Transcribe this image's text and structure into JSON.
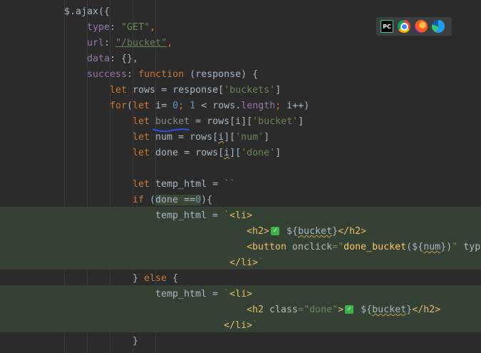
{
  "code_lines": [
    {
      "indent": "$",
      "parts": []
    },
    {
      "parts": []
    }
  ],
  "editor": {
    "lines": [
      {
        "segments": [
          {
            "t": "$.ajax({",
            "c": "plain"
          }
        ]
      },
      {
        "segments": [
          {
            "t": "type",
            "c": "prop"
          },
          {
            "t": ": ",
            "c": "plain"
          },
          {
            "t": "\"GET\"",
            "c": "str"
          },
          {
            "t": ",",
            "c": "kw"
          }
        ]
      },
      {
        "segments": [
          {
            "t": "url",
            "c": "prop"
          },
          {
            "t": ": ",
            "c": "plain"
          },
          {
            "t": "\"/bucket\"",
            "c": "str ul"
          },
          {
            "t": ",",
            "c": "kw"
          }
        ]
      },
      {
        "segments": [
          {
            "t": "data",
            "c": "prop"
          },
          {
            "t": ": {},",
            "c": "plain"
          }
        ]
      },
      {
        "segments": [
          {
            "t": "success",
            "c": "prop"
          },
          {
            "t": ": ",
            "c": "plain"
          },
          {
            "t": "function",
            "c": "kw"
          },
          {
            "t": " (response) {",
            "c": "plain"
          }
        ]
      },
      {
        "segments": [
          {
            "t": "let",
            "c": "kw"
          },
          {
            "t": " rows = response[",
            "c": "plain"
          },
          {
            "t": "'buckets'",
            "c": "str"
          },
          {
            "t": "]",
            "c": "plain"
          }
        ]
      },
      {
        "segments": [
          {
            "t": "for",
            "c": "kw"
          },
          {
            "t": "(",
            "c": "plain"
          },
          {
            "t": "let",
            "c": "kw"
          },
          {
            "t": " i= ",
            "c": "plain"
          },
          {
            "t": "0",
            "c": "num"
          },
          {
            "t": "; ",
            "c": "kw"
          },
          {
            "t": "1",
            "c": "num"
          },
          {
            "t": " < rows.",
            "c": "plain"
          },
          {
            "t": "length",
            "c": "prop"
          },
          {
            "t": "; ",
            "c": "kw"
          },
          {
            "t": "i++)",
            "c": "plain"
          }
        ]
      },
      {
        "segments": [
          {
            "t": "let",
            "c": "kw"
          },
          {
            "t": " ",
            "c": "plain"
          },
          {
            "t": "bucket",
            "c": "dim"
          },
          {
            "t": " = rows[i][",
            "c": "plain"
          },
          {
            "t": "'bucket'",
            "c": "str"
          },
          {
            "t": "]",
            "c": "plain"
          }
        ]
      },
      {
        "segments": [
          {
            "t": "let",
            "c": "kw"
          },
          {
            "t": " num = rows[",
            "c": "plain"
          },
          {
            "t": "i",
            "c": "plain wavy"
          },
          {
            "t": "][",
            "c": "plain"
          },
          {
            "t": "'num'",
            "c": "str"
          },
          {
            "t": "]",
            "c": "plain"
          }
        ]
      },
      {
        "segments": [
          {
            "t": "let",
            "c": "kw"
          },
          {
            "t": " done = rows[",
            "c": "plain"
          },
          {
            "t": "i",
            "c": "plain wavy"
          },
          {
            "t": "][",
            "c": "plain"
          },
          {
            "t": "'done'",
            "c": "str"
          },
          {
            "t": "]",
            "c": "plain"
          }
        ]
      },
      {
        "segments": []
      },
      {
        "segments": [
          {
            "t": "let",
            "c": "kw"
          },
          {
            "t": " temp_html = ",
            "c": "plain"
          },
          {
            "t": "``",
            "c": "str"
          }
        ]
      },
      {
        "segments": [
          {
            "t": "if",
            "c": "kw"
          },
          {
            "t": " (",
            "c": "plain"
          },
          {
            "t": "done ==",
            "c": "plain hl-done"
          },
          {
            "t": "0",
            "c": "num hl-done"
          },
          {
            "t": "){",
            "c": "plain"
          }
        ]
      },
      {
        "segments": [
          {
            "t": "temp_html = ",
            "c": "plain"
          },
          {
            "t": "`",
            "c": "str"
          },
          {
            "t": "<li>",
            "c": "tag"
          }
        ]
      },
      {
        "segments": [
          {
            "t": "<h2>",
            "c": "tag"
          },
          {
            "t": "CHECK",
            "c": "check"
          },
          {
            "t": " ${",
            "c": "plain"
          },
          {
            "t": "bucket",
            "c": "plain wavy"
          },
          {
            "t": "}",
            "c": "plain"
          },
          {
            "t": "</h2>",
            "c": "tag"
          }
        ]
      },
      {
        "segments": [
          {
            "t": "<button",
            "c": "tag"
          },
          {
            "t": " onclick",
            "c": "attr"
          },
          {
            "t": "=\"",
            "c": "str"
          },
          {
            "t": "done_bucket",
            "c": "fn"
          },
          {
            "t": "(${",
            "c": "plain"
          },
          {
            "t": "num",
            "c": "plain wavy"
          },
          {
            "t": "})",
            "c": "plain"
          },
          {
            "t": "\"",
            "c": "str"
          },
          {
            "t": " type",
            "c": "attr"
          }
        ]
      },
      {
        "segments": [
          {
            "t": "</li>",
            "c": "tag"
          },
          {
            "t": "`",
            "c": "str"
          }
        ]
      },
      {
        "segments": [
          {
            "t": "} ",
            "c": "plain"
          },
          {
            "t": "else",
            "c": "kw"
          },
          {
            "t": " {",
            "c": "plain"
          }
        ]
      },
      {
        "segments": [
          {
            "t": "temp_html = ",
            "c": "plain"
          },
          {
            "t": "`",
            "c": "str"
          },
          {
            "t": "<li>",
            "c": "tag"
          }
        ]
      },
      {
        "segments": [
          {
            "t": "<h2",
            "c": "tag"
          },
          {
            "t": " class",
            "c": "attr"
          },
          {
            "t": "=\"done\"",
            "c": "str"
          },
          {
            "t": ">",
            "c": "tag"
          },
          {
            "t": "CHECK",
            "c": "check"
          },
          {
            "t": " ${",
            "c": "plain"
          },
          {
            "t": "bucket",
            "c": "plain wavy"
          },
          {
            "t": "}",
            "c": "plain"
          },
          {
            "t": "</h2>",
            "c": "tag"
          }
        ]
      },
      {
        "segments": [
          {
            "t": "</li>",
            "c": "tag"
          },
          {
            "t": "`",
            "c": "str"
          }
        ]
      },
      {
        "segments": [
          {
            "t": "}",
            "c": "plain"
          }
        ]
      }
    ]
  },
  "browser_bar": {
    "icons": [
      "pycharm-icon",
      "chrome-icon",
      "firefox-icon",
      "edge-icon"
    ],
    "pycharm_label": "PC"
  },
  "colors": {
    "background": "#2b2b2b",
    "keyword": "#cc7832",
    "string": "#6a8759",
    "property": "#9876aa",
    "number": "#6897bb",
    "tag": "#e8bf6a"
  }
}
